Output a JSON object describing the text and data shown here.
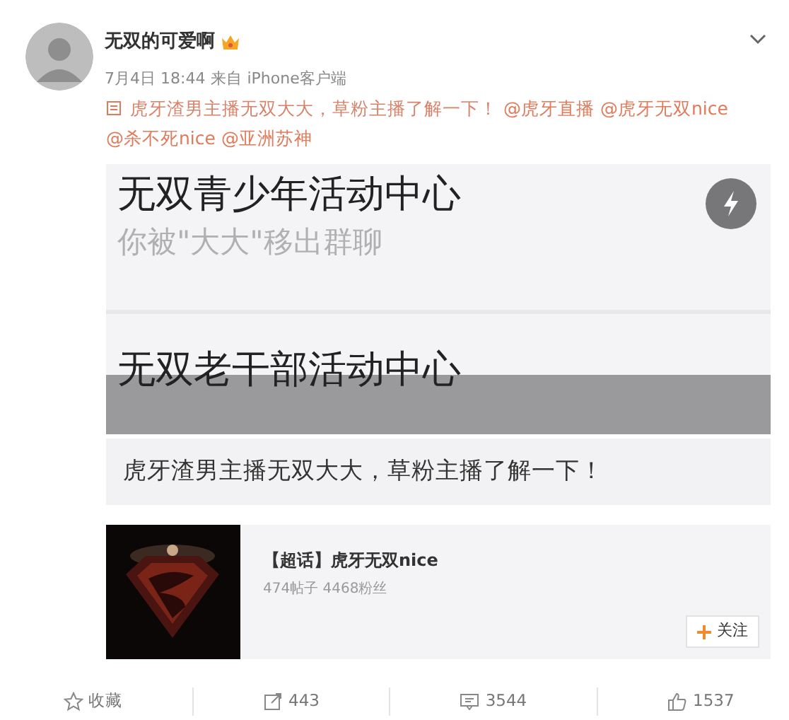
{
  "post": {
    "author": "无双的可爱啊",
    "date": "7月4日 18:44",
    "source": "来自 iPhone客户端",
    "content": [
      {
        "kind": "text",
        "text": "虎牙渣男主播无双大大，草粉主播了解一下！"
      },
      {
        "kind": "mention",
        "text": "@虎牙直播"
      },
      {
        "kind": "mention",
        "text": "@虎牙无双nice"
      },
      {
        "kind": "mention",
        "text": "@杀不死nice"
      },
      {
        "kind": "mention",
        "text": "@亚洲苏神"
      }
    ]
  },
  "image": {
    "chats": [
      {
        "title": "无双青少年活动中心",
        "subtitle": "你被\"大大\"移出群聊"
      },
      {
        "title": "无双老干部活动中心"
      }
    ],
    "caption": "虎牙渣男主播无双大大，草粉主播了解一下！"
  },
  "topic_card": {
    "title": "【超话】虎牙无双nice",
    "stats": "474帖子 4468粉丝",
    "follow": "关注"
  },
  "actions": [
    {
      "kind": "favorite",
      "label": "收藏"
    },
    {
      "kind": "repost",
      "label": "443"
    },
    {
      "kind": "comment",
      "label": "3544"
    },
    {
      "kind": "like",
      "label": "1537"
    }
  ]
}
